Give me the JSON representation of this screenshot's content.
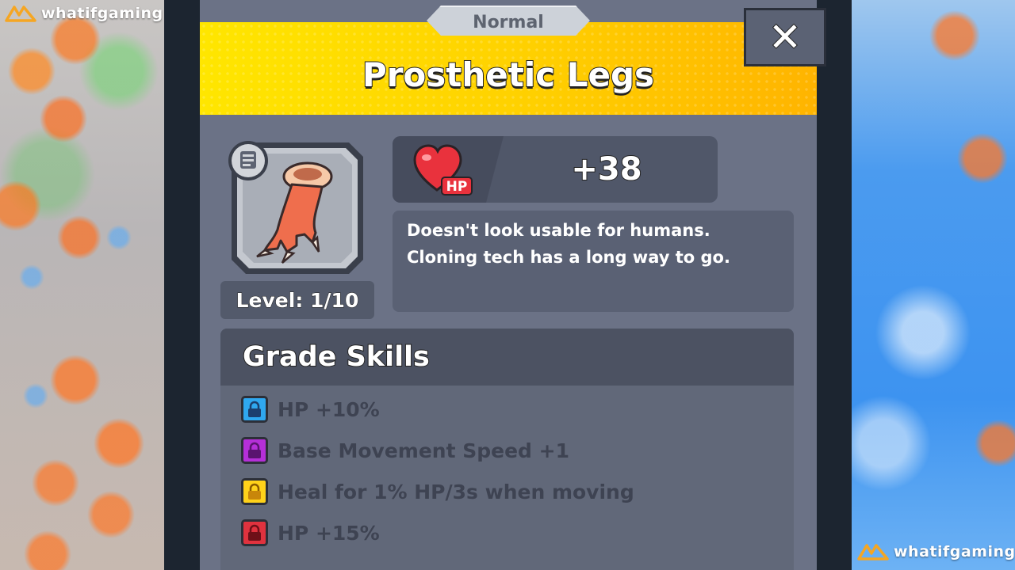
{
  "watermark": {
    "text": "whatifgaming"
  },
  "dialog": {
    "rarity": "Normal",
    "title": "Prosthetic Legs",
    "close_symbol": "✕",
    "item": {
      "icon": "prosthetic-legs-icon",
      "badge_icon": "scroll-icon",
      "level_text": "Level: 1/10"
    },
    "stat": {
      "icon": "heart-hp-icon",
      "icon_label": "HP",
      "value": "+38"
    },
    "description": [
      "Doesn't look usable for humans.",
      "Cloning tech has a long way to go."
    ],
    "grade_skills": {
      "heading": "Grade Skills",
      "skills": [
        {
          "text": "HP +10%",
          "lock_color": "#2fa8f0",
          "locked": true
        },
        {
          "text": "Base Movement Speed +1",
          "lock_color": "#b52fd8",
          "locked": true
        },
        {
          "text": "Heal for 1% HP/3s when moving",
          "lock_color": "#ffd21a",
          "locked": true
        },
        {
          "text": "HP +15%",
          "lock_color": "#e0323e",
          "locked": true
        }
      ]
    }
  },
  "colors": {
    "header_yellow": "#ffd200",
    "panel_bg": "#6b7286"
  }
}
